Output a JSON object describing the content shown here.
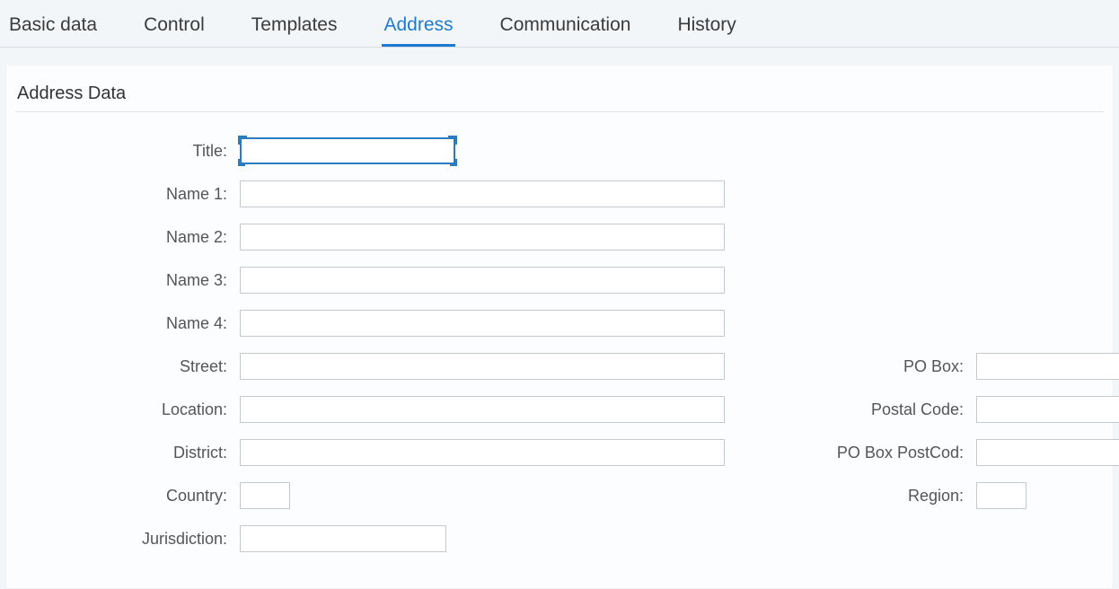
{
  "tabs": {
    "basic_data": "Basic data",
    "control": "Control",
    "templates": "Templates",
    "address": "Address",
    "communication": "Communication",
    "history": "History",
    "active": "address"
  },
  "section": {
    "title": "Address Data"
  },
  "labels": {
    "title": "Title:",
    "name1": "Name 1:",
    "name2": "Name 2:",
    "name3": "Name 3:",
    "name4": "Name 4:",
    "street": "Street:",
    "location": "Location:",
    "district": "District:",
    "country": "Country:",
    "jurisdiction": "Jurisdiction:",
    "po_box": "PO Box:",
    "postal_code": "Postal Code:",
    "po_box_postcod": "PO Box PostCod:",
    "region": "Region:"
  },
  "values": {
    "title": "",
    "name1": "",
    "name2": "",
    "name3": "",
    "name4": "",
    "street": "",
    "location": "",
    "district": "",
    "country": "",
    "jurisdiction": "",
    "po_box": "",
    "postal_code": "",
    "po_box_postcod": "",
    "region": ""
  }
}
